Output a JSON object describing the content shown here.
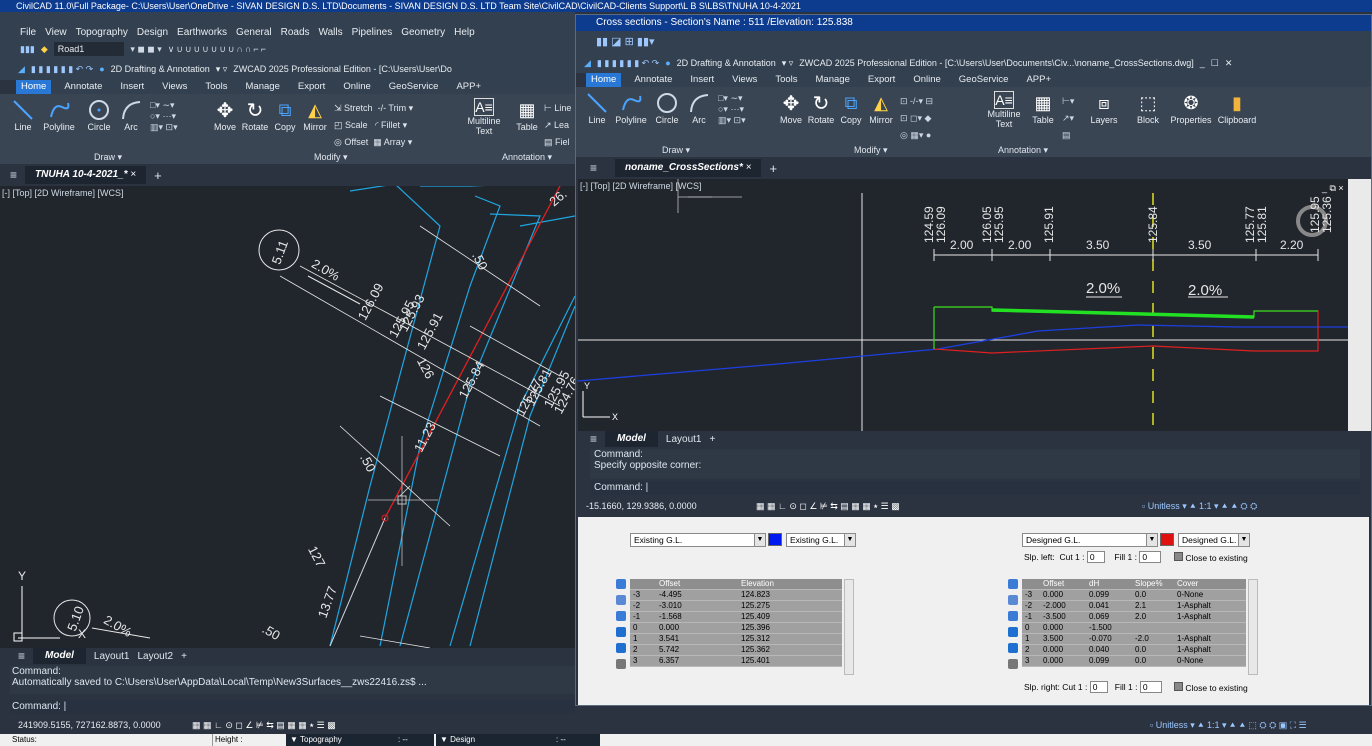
{
  "main": {
    "title": "CivilCAD 11.0\\Full Package- C:\\Users\\User\\OneDrive - SIVAN DESIGN D.S. LTD\\Documents - SIVAN DESIGN D.S. LTD Team Site\\CivilCAD\\CivilCAD-Clients Support\\L B S\\LBS\\TNUHA 10-4-2021",
    "menu": [
      "File",
      "View",
      "Topography",
      "Design",
      "Earthworks",
      "General",
      "Roads",
      "Walls",
      "Pipelines",
      "Geometry",
      "Help"
    ],
    "qat_layer": "Road1",
    "workspace": "2D Drafting & Annotation",
    "edition_title": "ZWCAD 2025 Professional Edition - [C:\\Users\\User\\Do",
    "ribbon_tabs": [
      "Home",
      "Annotate",
      "Insert",
      "Views",
      "Tools",
      "Manage",
      "Export",
      "Online",
      "GeoService",
      "APP+"
    ],
    "draw_tools": [
      "Line",
      "Polyline",
      "Circle",
      "Arc"
    ],
    "modify_tools": [
      "Move",
      "Rotate",
      "Copy",
      "Mirror"
    ],
    "modify_small": [
      "Stretch",
      "Trim",
      "Scale",
      "Fillet",
      "Offset",
      "Array"
    ],
    "panels": {
      "draw": "Draw",
      "modify": "Modify",
      "annotation": "Annotation"
    },
    "annotation_tools": [
      "Multiline Text",
      "Table"
    ],
    "annotation_small": [
      "Line",
      "Lea",
      "Fiel"
    ],
    "doc_tab": "TNUHA 10-4-2021_*",
    "viewport_label": "[-] [Top] [2D Wireframe] [WCS]",
    "layout_tabs": [
      "Model",
      "Layout1",
      "Layout2"
    ],
    "command_lines": [
      "Command:",
      "Automatically saved to C:\\Users\\User\\AppData\\Local\\Temp\\New3Surfaces__zws22416.zs$ ..."
    ],
    "command_prompt": "Command:",
    "coords": "241909.5155, 727162.8873, 0.0000",
    "units": "Unitless",
    "scale": "1:1",
    "status": {
      "status": "Status:",
      "height": "Height :",
      "topo": "Topography",
      "design": "Design",
      "dash": ":  --"
    },
    "drawing_labels": [
      "5.11",
      "2.0%",
      "126.09",
      "125.95",
      "125.93",
      "125.91",
      "126",
      "125.84",
      "11.23",
      ".50",
      "125.77",
      "125.81",
      "125.95",
      "124.76",
      "127",
      "13.77",
      "5.10",
      "2.0%",
      ".50",
      ".50",
      "26."
    ]
  },
  "cross": {
    "title": "Cross sections - Section's Name : 511   /Elevation: 125.838",
    "workspace": "2D Drafting & Annotation",
    "edition_title": "ZWCAD 2025 Professional Edition - [C:\\Users\\User\\Documents\\Civ...\\noname_CrossSections.dwg]",
    "ribbon_tabs": [
      "Home",
      "Annotate",
      "Insert",
      "Views",
      "Tools",
      "Manage",
      "Export",
      "Online",
      "GeoService",
      "APP+"
    ],
    "draw_tools": [
      "Line",
      "Polyline",
      "Circle",
      "Arc"
    ],
    "modify_tools": [
      "Move",
      "Rotate",
      "Copy",
      "Mirror"
    ],
    "big_tools": [
      "Layers",
      "Block",
      "Properties",
      "Clipboard"
    ],
    "panels": {
      "draw": "Draw",
      "modify": "Modify",
      "annotation": "Annotation"
    },
    "annotation_tools": [
      "Multiline Text",
      "Table"
    ],
    "doc_tab": "noname_CrossSections*",
    "viewport_label": "[-] [Top] [2D Wireframe] [WCS]",
    "elev_labels": [
      "124.59",
      "126.09",
      "126.05",
      "125.95",
      "125.91",
      "125.84",
      "125.77",
      "125.81",
      "125.95",
      "125.36"
    ],
    "widths": [
      "2.00",
      "2.00",
      "3.50",
      "3.50",
      "2.20"
    ],
    "slopes": [
      "2.0%",
      "2.0%"
    ],
    "layout_tabs": [
      "Model",
      "Layout1"
    ],
    "command_lines": [
      "Command:",
      "Specify opposite corner:"
    ],
    "command_prompt": "Command:",
    "coords": "-15.1660, 129.9386, 0.0000",
    "units": "Unitless",
    "scale": "1:1"
  },
  "existing": {
    "dropdown1": "Existing G.L.",
    "dropdown2": "Existing G.L.",
    "color": "#0018f0",
    "headers": [
      "",
      "Offset",
      "Elevation"
    ],
    "rows": [
      [
        "-3",
        "-4.495",
        "124.823"
      ],
      [
        "-2",
        "-3.010",
        "125.275"
      ],
      [
        "-1",
        "-1.568",
        "125.409"
      ],
      [
        "0",
        "0.000",
        "125.396"
      ],
      [
        "1",
        "3.541",
        "125.312"
      ],
      [
        "2",
        "5.742",
        "125.362"
      ],
      [
        "3",
        "6.357",
        "125.401"
      ]
    ]
  },
  "designed": {
    "dropdown1": "Designed G.L.",
    "dropdown2": "Designed G.L.",
    "color": "#e01010",
    "slp_left": "Slp. left:",
    "cut": "Cut 1 :",
    "cut_left": "0",
    "fill": "Fill 1 :",
    "fill_left": "0",
    "close": "Close to existing",
    "slp_right": "Slp. right:",
    "cut_right": "0",
    "fill_right": "0",
    "headers": [
      "",
      "Offset",
      "dH",
      "Slope%",
      "Cover"
    ],
    "rows": [
      [
        "-3",
        "0.000",
        "0.099",
        "0.0",
        "0-None"
      ],
      [
        "-2",
        "-2.000",
        "0.041",
        "2.1",
        "1-Asphalt"
      ],
      [
        "-1",
        "-3.500",
        "0.069",
        "2.0",
        "1-Asphalt"
      ],
      [
        "0",
        "0.000",
        "-1.500",
        "",
        ""
      ],
      [
        "1",
        "3.500",
        "-0.070",
        "-2.0",
        "1-Asphalt"
      ],
      [
        "2",
        "0.000",
        "0.040",
        "0.0",
        "1-Asphalt"
      ],
      [
        "3",
        "0.000",
        "0.099",
        "0.0",
        "0-None"
      ]
    ]
  }
}
